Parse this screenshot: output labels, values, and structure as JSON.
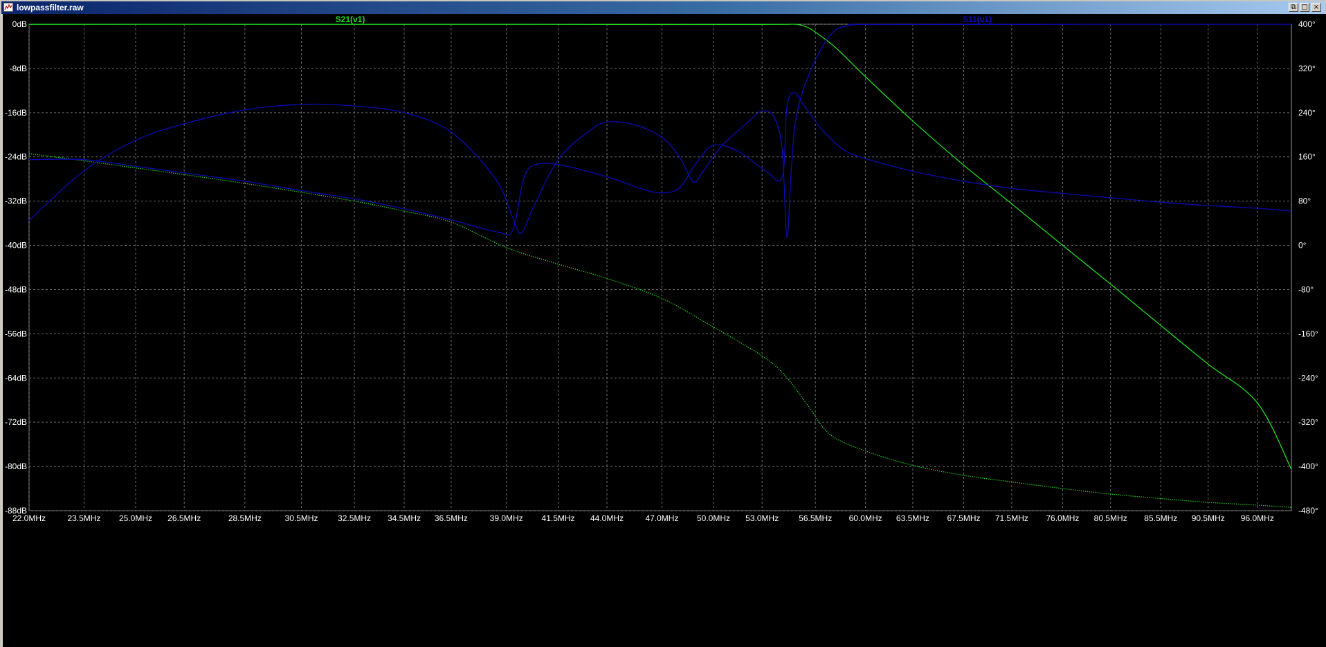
{
  "window": {
    "title": "lowpassfilter.raw",
    "controls": {
      "restore": "⧉",
      "maximize": "□",
      "close": "×"
    }
  },
  "colors": {
    "background": "#000000",
    "grid": "#6e6e6e",
    "s21": "#1edc1e",
    "s11": "#0a0ab4",
    "axis_text": "#ffffff"
  },
  "chart_data": {
    "type": "line",
    "title": "",
    "xlabel": "",
    "ylabel_left": "",
    "ylabel_right": "",
    "x_scale": "log",
    "x_range_mhz": [
      22,
      100
    ],
    "y_left_range_db": [
      -88,
      0
    ],
    "y_right_range_deg": [
      -480,
      400
    ],
    "grid": true,
    "legend_placement": "top",
    "x_ticks": [
      22.0,
      23.5,
      25.0,
      26.5,
      28.5,
      30.5,
      32.5,
      34.5,
      36.5,
      39.0,
      41.5,
      44.0,
      47.0,
      50.0,
      53.0,
      56.5,
      60.0,
      63.5,
      67.5,
      71.5,
      76.0,
      80.5,
      85.5,
      90.5,
      96.0
    ],
    "x_tick_labels": [
      "22.0MHz",
      "23.5MHz",
      "25.0MHz",
      "26.5MHz",
      "28.5MHz",
      "30.5MHz",
      "32.5MHz",
      "34.5MHz",
      "36.5MHz",
      "39.0MHz",
      "41.5MHz",
      "44.0MHz",
      "47.0MHz",
      "50.0MHz",
      "53.0MHz",
      "56.5MHz",
      "60.0MHz",
      "63.5MHz",
      "67.5MHz",
      "71.5MHz",
      "76.0MHz",
      "80.5MHz",
      "85.5MHz",
      "90.5MHz",
      "96.0MHz"
    ],
    "y_left_ticks": [
      0,
      -8,
      -16,
      -24,
      -32,
      -40,
      -48,
      -56,
      -64,
      -72,
      -80,
      -88
    ],
    "y_left_tick_labels": [
      "0dB",
      "-8dB",
      "-16dB",
      "-24dB",
      "-32dB",
      "-40dB",
      "-48dB",
      "-56dB",
      "-64dB",
      "-72dB",
      "-80dB",
      "-88dB"
    ],
    "y_right_ticks": [
      400,
      320,
      240,
      160,
      80,
      0,
      -80,
      -160,
      -240,
      -320,
      -400,
      -480
    ],
    "y_right_tick_labels": [
      "400°",
      "320°",
      "240°",
      "160°",
      "80°",
      "0°",
      "-80°",
      "-160°",
      "-240°",
      "-320°",
      "-400°",
      "-480°"
    ],
    "series": [
      {
        "name": "S21(v1)",
        "quantity": "magnitude_db",
        "axis": "left",
        "style": "solid",
        "color": "#1edc1e",
        "points": [
          [
            22.0,
            -0.02
          ],
          [
            30,
            -0.02
          ],
          [
            40,
            -0.03
          ],
          [
            50,
            -0.05
          ],
          [
            53,
            -0.05
          ],
          [
            54.5,
            -0.02
          ],
          [
            55.3,
            -0.05
          ],
          [
            56.0,
            -0.6
          ],
          [
            56.8,
            -2.0
          ],
          [
            58.0,
            -4.5
          ],
          [
            60.0,
            -9.5
          ],
          [
            63.5,
            -17.5
          ],
          [
            67.5,
            -25.5
          ],
          [
            71.5,
            -32.5
          ],
          [
            76.0,
            -40.0
          ],
          [
            80.5,
            -47.0
          ],
          [
            85.5,
            -54.5
          ],
          [
            90.5,
            -61.5
          ],
          [
            96.0,
            -68.5
          ],
          [
            100.0,
            -80.5
          ]
        ]
      },
      {
        "name": "S21(v1)",
        "quantity": "phase_deg",
        "axis": "right",
        "style": "dotted",
        "color": "#1edc1e",
        "points": [
          [
            22.0,
            166
          ],
          [
            23.5,
            153
          ],
          [
            25.0,
            140
          ],
          [
            26.5,
            128
          ],
          [
            28.5,
            112
          ],
          [
            30.5,
            96
          ],
          [
            32.5,
            80
          ],
          [
            34.5,
            62
          ],
          [
            36.5,
            42
          ],
          [
            39.0,
            -4
          ],
          [
            41.5,
            -34
          ],
          [
            44.0,
            -60
          ],
          [
            47.0,
            -96
          ],
          [
            50.0,
            -148
          ],
          [
            53.0,
            -200
          ],
          [
            54.5,
            -236
          ],
          [
            56.0,
            -290
          ],
          [
            57.5,
            -342
          ],
          [
            60.0,
            -372
          ],
          [
            63.5,
            -398
          ],
          [
            67.5,
            -416
          ],
          [
            71.5,
            -428
          ],
          [
            76.0,
            -440
          ],
          [
            80.5,
            -450
          ],
          [
            85.5,
            -458
          ],
          [
            90.5,
            -465
          ],
          [
            96.0,
            -470
          ],
          [
            100.0,
            -474
          ]
        ]
      },
      {
        "name": "S11(v1)",
        "quantity": "magnitude_db",
        "axis": "left",
        "style": "solid",
        "color": "#0a0ab4",
        "points": [
          [
            22.0,
            -35.5
          ],
          [
            23.5,
            -26.5
          ],
          [
            25.0,
            -21.0
          ],
          [
            26.5,
            -18.0
          ],
          [
            28.5,
            -15.5
          ],
          [
            30.5,
            -14.5
          ],
          [
            32.5,
            -14.8
          ],
          [
            34.5,
            -16.0
          ],
          [
            36.5,
            -19.5
          ],
          [
            38.5,
            -28.0
          ],
          [
            39.3,
            -35.0
          ],
          [
            39.7,
            -37.8
          ],
          [
            40.3,
            -33.0
          ],
          [
            41.5,
            -24.5
          ],
          [
            43.0,
            -19.5
          ],
          [
            44.0,
            -17.7
          ],
          [
            45.5,
            -18.2
          ],
          [
            47.0,
            -20.5
          ],
          [
            48.0,
            -24.0
          ],
          [
            48.8,
            -28.5
          ],
          [
            49.4,
            -26.5
          ],
          [
            50.5,
            -22.0
          ],
          [
            52.0,
            -18.0
          ],
          [
            53.0,
            -15.7
          ],
          [
            53.8,
            -17.0
          ],
          [
            54.3,
            -23.0
          ],
          [
            54.6,
            -38.5
          ],
          [
            54.9,
            -26.0
          ],
          [
            55.2,
            -17.0
          ],
          [
            56.0,
            -9.5
          ],
          [
            57.5,
            -2.0
          ],
          [
            59.0,
            -0.2
          ],
          [
            62.0,
            -0.05
          ],
          [
            100.0,
            -0.01
          ]
        ]
      },
      {
        "name": "S11(v1)",
        "quantity": "phase_deg",
        "axis": "right",
        "style": "solid",
        "color": "#0a0ab4",
        "points": [
          [
            22.0,
            155
          ],
          [
            23.5,
            155
          ],
          [
            25.0,
            143
          ],
          [
            26.5,
            131
          ],
          [
            28.5,
            116
          ],
          [
            30.5,
            99
          ],
          [
            32.5,
            84
          ],
          [
            34.5,
            66
          ],
          [
            36.5,
            46
          ],
          [
            38.6,
            24
          ],
          [
            39.3,
            28
          ],
          [
            39.8,
            118
          ],
          [
            40.3,
            145
          ],
          [
            41.5,
            146
          ],
          [
            44.0,
            124
          ],
          [
            46.0,
            101
          ],
          [
            47.0,
            95
          ],
          [
            48.0,
            104
          ],
          [
            49.0,
            150
          ],
          [
            50.0,
            181
          ],
          [
            51.5,
            170
          ],
          [
            53.3,
            133
          ],
          [
            54.3,
            124
          ],
          [
            54.6,
            250
          ],
          [
            55.1,
            276
          ],
          [
            55.8,
            250
          ],
          [
            57.0,
            208
          ],
          [
            58.5,
            172
          ],
          [
            60.0,
            157
          ],
          [
            63.5,
            134
          ],
          [
            67.5,
            116
          ],
          [
            71.5,
            103
          ],
          [
            76.0,
            94
          ],
          [
            80.5,
            86
          ],
          [
            85.5,
            78
          ],
          [
            90.5,
            72
          ],
          [
            96.0,
            67
          ],
          [
            100.0,
            62
          ]
        ]
      }
    ]
  }
}
